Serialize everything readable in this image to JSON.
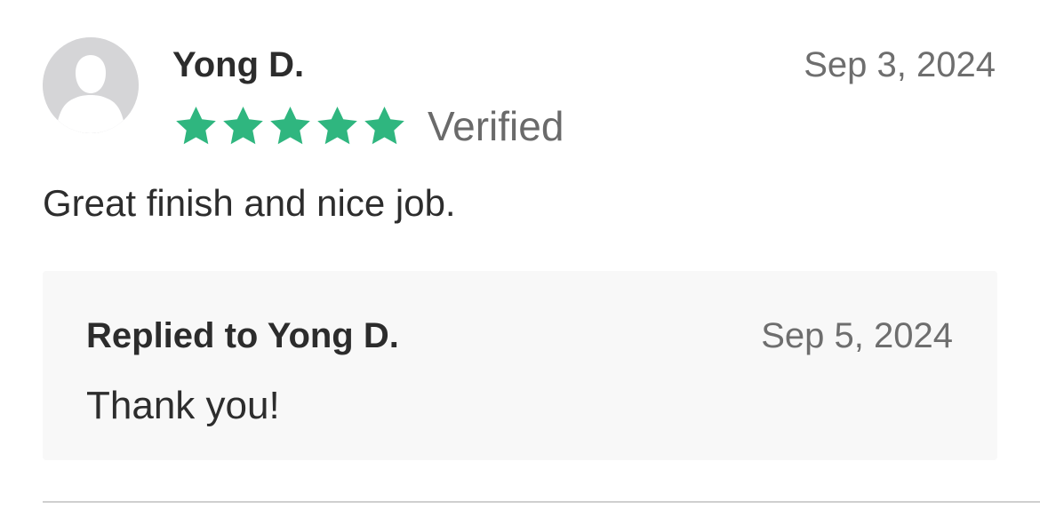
{
  "review": {
    "reviewer_name": "Yong D.",
    "date": "Sep 3, 2024",
    "rating": 5,
    "rating_max": 5,
    "verified_label": "Verified",
    "text": "Great finish and nice job.",
    "avatar_icon": "user-silhouette-icon",
    "star_icon": "star-icon"
  },
  "reply": {
    "title": "Replied to Yong D.",
    "date": "Sep 5, 2024",
    "text": "Thank you!"
  },
  "colors": {
    "star": "#2fb67f",
    "avatar_background": "#d5d5d7",
    "reply_background": "#f8f8f8",
    "muted_text": "#6e6e6e"
  }
}
